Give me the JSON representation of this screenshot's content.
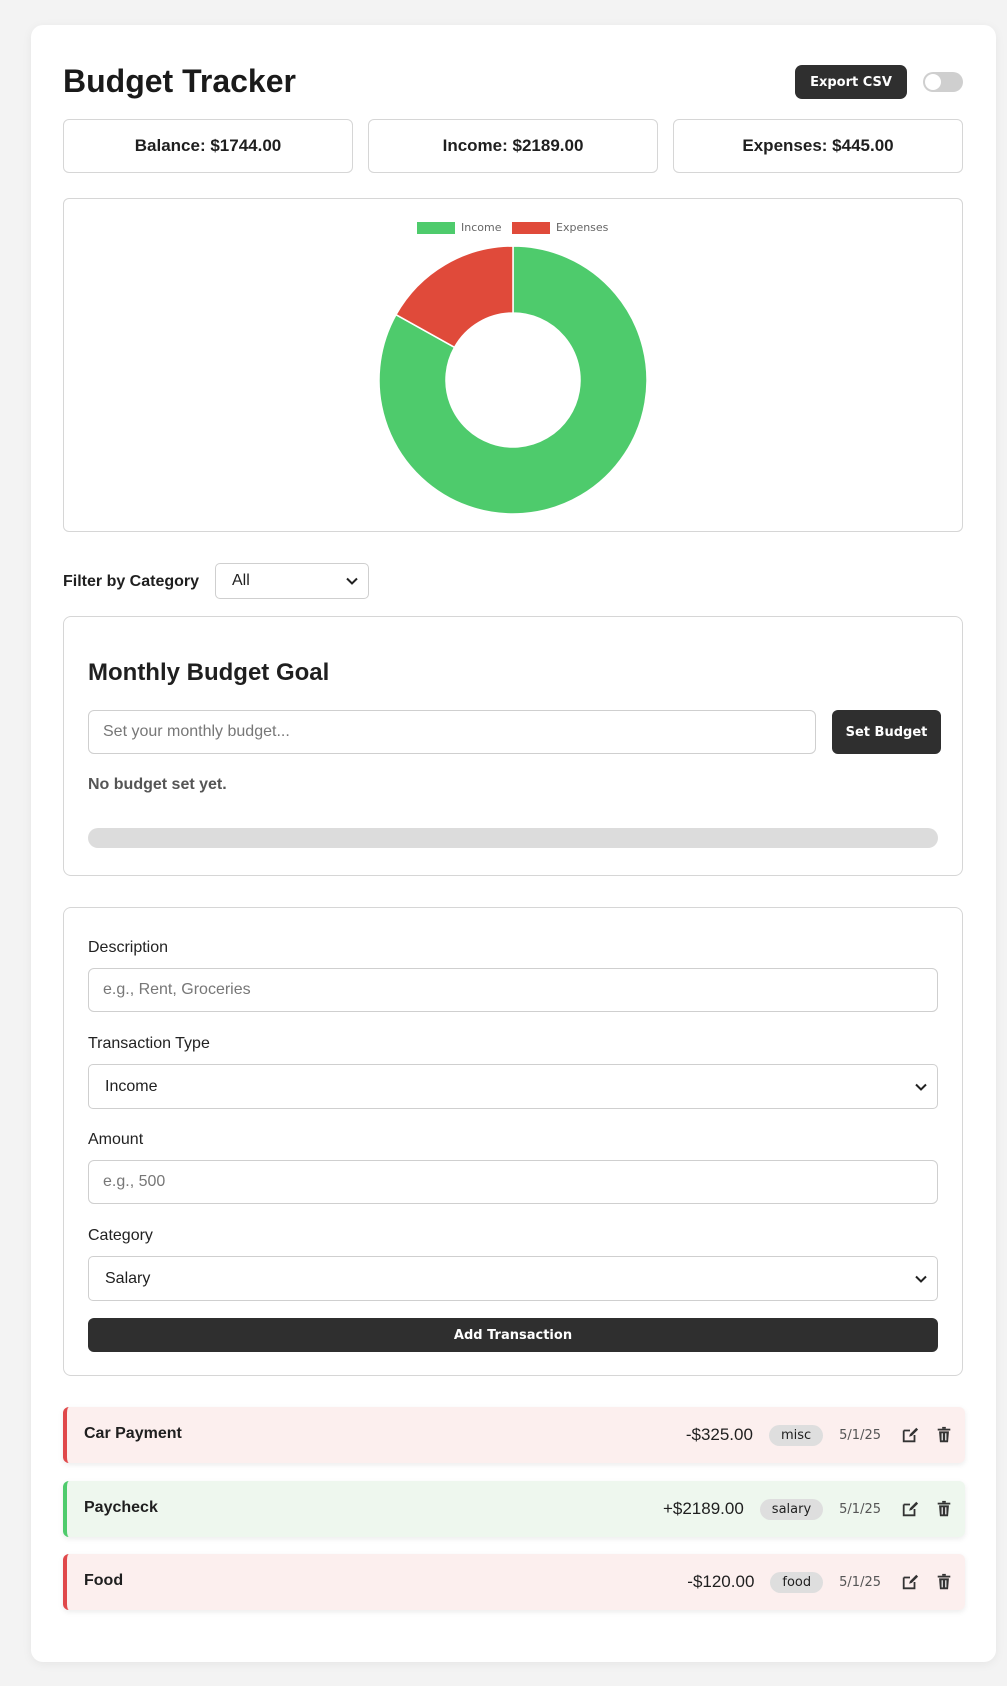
{
  "header": {
    "title": "Budget Tracker",
    "export_label": "Export CSV",
    "theme_toggle_on": false
  },
  "stats": {
    "balance": "Balance: $1744.00",
    "income": "Income: $2189.00",
    "expenses": "Expenses: $445.00"
  },
  "chart_data": {
    "type": "pie",
    "categories": [
      "Income",
      "Expenses"
    ],
    "values": [
      2189,
      445
    ],
    "colors": [
      "#4ecb6c",
      "#e04a3a"
    ],
    "donut": true,
    "legend": "top"
  },
  "filter": {
    "label": "Filter by Category",
    "selected": "All"
  },
  "goal": {
    "title": "Monthly Budget Goal",
    "placeholder": "Set your monthly budget...",
    "button_label": "Set Budget",
    "status": "No budget set yet.",
    "progress": 0
  },
  "form": {
    "description_label": "Description",
    "description_placeholder": "e.g., Rent, Groceries",
    "type_label": "Transaction Type",
    "type_selected": "Income",
    "amount_label": "Amount",
    "amount_placeholder": "e.g., 500",
    "category_label": "Category",
    "category_selected": "Salary",
    "submit_label": "Add Transaction"
  },
  "transactions": [
    {
      "description": "Car Payment",
      "amount": "-$325.00",
      "category": "misc",
      "date": "5/1/25",
      "kind": "expense"
    },
    {
      "description": "Paycheck",
      "amount": "+$2189.00",
      "category": "salary",
      "date": "5/1/25",
      "kind": "income"
    },
    {
      "description": "Food",
      "amount": "-$120.00",
      "category": "food",
      "date": "5/1/25",
      "kind": "expense"
    }
  ]
}
